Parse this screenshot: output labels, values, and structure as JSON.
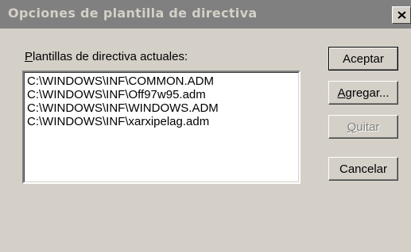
{
  "window": {
    "title": "Opciones de plantilla de directiva",
    "close_glyph": "✕"
  },
  "list": {
    "label_mnemonic": "P",
    "label_rest": "lantillas de directiva actuales:",
    "items": [
      "C:\\WINDOWS\\INF\\COMMON.ADM",
      "C:\\WINDOWS\\INF\\Off97w95.adm",
      "C:\\WINDOWS\\INF\\WINDOWS.ADM",
      "C:\\WINDOWS\\INF\\xarxipelag.adm"
    ]
  },
  "buttons": {
    "accept_label": "Aceptar",
    "add_mnemonic": "A",
    "add_rest": "gregar...",
    "remove_mnemonic": "Q",
    "remove_rest": "uitar",
    "remove_enabled": false,
    "cancel_label": "Cancelar"
  },
  "colors": {
    "title_bar_inactive": "#808080",
    "title_text_inactive": "#d4d0c8",
    "face": "#d4d0c8",
    "list_background": "#ffffff"
  },
  "icons": {
    "close": "close-icon"
  }
}
